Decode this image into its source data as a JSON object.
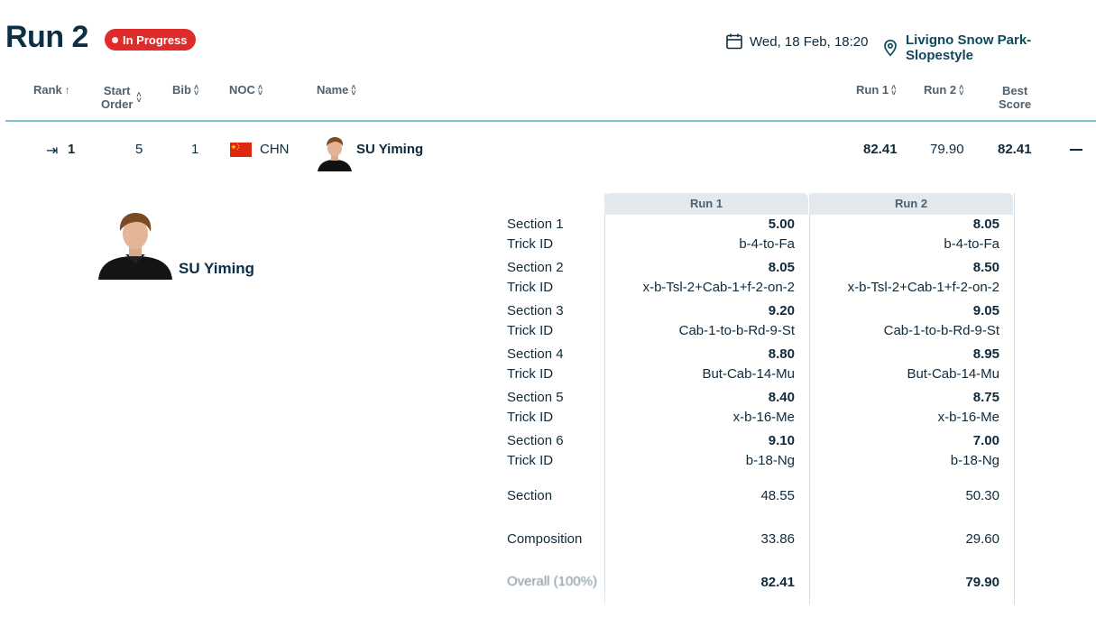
{
  "header": {
    "title": "Run 2",
    "status": "In Progress",
    "date": "Wed, 18 Feb, 18:20",
    "venue": "Livigno Snow Park-Slopestyle"
  },
  "columns": {
    "rank": "Rank",
    "start_order_1": "Start",
    "start_order_2": "Order",
    "bib": "Bib",
    "noc": "NOC",
    "name": "Name",
    "run1": "Run 1",
    "run2": "Run 2",
    "best_1": "Best",
    "best_2": "Score"
  },
  "row": {
    "rank": "1",
    "start_order": "5",
    "bib": "1",
    "noc": "CHN",
    "name": "SU Yiming",
    "run1": "82.41",
    "run2": "79.90",
    "best": "82.41"
  },
  "detail": {
    "name": "SU Yiming",
    "run_headers": [
      "Run 1",
      "Run 2"
    ],
    "labels": {
      "section1": "Section 1",
      "section2": "Section 2",
      "section3": "Section 3",
      "section4": "Section 4",
      "section5": "Section 5",
      "section6": "Section 6",
      "trick": "Trick ID",
      "section": "Section",
      "composition": "Composition",
      "overall": "Overall (100%)"
    },
    "run1": {
      "s1": "5.00",
      "t1": "b-4-to-Fa",
      "s2": "8.05",
      "t2": "x-b-Tsl-2+Cab-1+f-2-on-2",
      "s3": "9.20",
      "t3": "Cab-1-to-b-Rd-9-St",
      "s4": "8.80",
      "t4": "But-Cab-14-Mu",
      "s5": "8.40",
      "t5": "x-b-16-Me",
      "s6": "9.10",
      "t6": "b-18-Ng",
      "section": "48.55",
      "composition": "33.86",
      "overall": "82.41"
    },
    "run2": {
      "s1": "8.05",
      "t1": "b-4-to-Fa",
      "s2": "8.50",
      "t2": "x-b-Tsl-2+Cab-1+f-2-on-2",
      "s3": "9.05",
      "t3": "Cab-1-to-b-Rd-9-St",
      "s4": "8.95",
      "t4": "But-Cab-14-Mu",
      "s5": "8.75",
      "t5": "x-b-16-Me",
      "s6": "7.00",
      "t6": "b-18-Ng",
      "section": "50.30",
      "composition": "29.60",
      "overall": "79.90"
    }
  },
  "colors": {
    "badge": "#e02b2b",
    "divider": "#7cc3d2",
    "flag": "#de2910",
    "title": "#0d2f45"
  },
  "icons": [
    "calendar-icon",
    "location-pin-icon",
    "sort-icon",
    "expand-arrow-icon",
    "collapse-icon",
    "flag-china-icon"
  ]
}
